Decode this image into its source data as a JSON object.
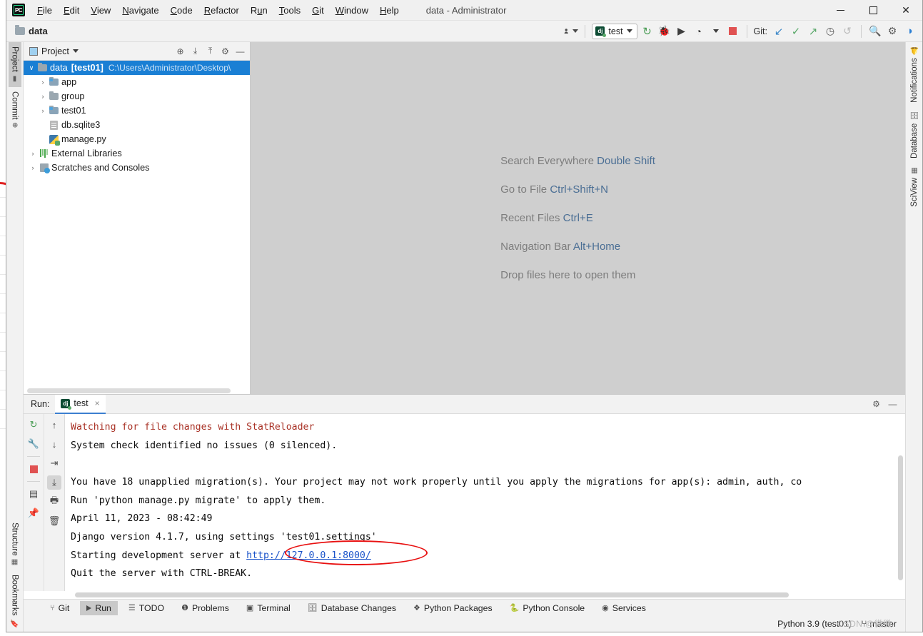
{
  "window": {
    "title": "data - Administrator",
    "app_icon": "pycharm-logo",
    "controls": {
      "minimize": "minimize",
      "maximize": "maximize",
      "close": "close"
    }
  },
  "menu": [
    {
      "label": "File",
      "mnemonic": "F"
    },
    {
      "label": "Edit",
      "mnemonic": "E"
    },
    {
      "label": "View",
      "mnemonic": "V"
    },
    {
      "label": "Navigate",
      "mnemonic": "N"
    },
    {
      "label": "Code",
      "mnemonic": "C"
    },
    {
      "label": "Refactor",
      "mnemonic": "R"
    },
    {
      "label": "Run",
      "mnemonic": "u"
    },
    {
      "label": "Tools",
      "mnemonic": "T"
    },
    {
      "label": "Git",
      "mnemonic": "G"
    },
    {
      "label": "Window",
      "mnemonic": "W"
    },
    {
      "label": "Help",
      "mnemonic": "H"
    }
  ],
  "navbar": {
    "breadcrumb": "data",
    "run_config": "test",
    "git_label": "Git:",
    "icons": [
      "user-select-icon",
      "rerun-icon",
      "debug-icon",
      "run-with-coverage-icon",
      "profile-icon",
      "stop-icon",
      "update-project-icon",
      "commit-icon",
      "push-icon",
      "history-icon",
      "rollback-icon",
      "search-icon",
      "settings-icon",
      "ide-assistant-icon"
    ]
  },
  "left_toolbar": [
    {
      "label": "Project",
      "icon": "project-icon",
      "active": true
    },
    {
      "label": "Commit",
      "icon": "commit-icon",
      "active": false
    }
  ],
  "left_toolbar_bottom": [
    {
      "label": "Structure",
      "icon": "structure-icon"
    },
    {
      "label": "Bookmarks",
      "icon": "bookmark-icon"
    }
  ],
  "right_toolbar": [
    {
      "label": "Notifications",
      "icon": "bell-icon"
    },
    {
      "label": "Database",
      "icon": "database-icon"
    },
    {
      "label": "SciView",
      "icon": "sciview-icon"
    }
  ],
  "project_panel": {
    "title": "Project",
    "actions": [
      "locate-icon",
      "expand-all-icon",
      "collapse-all-icon",
      "settings-icon",
      "hide-icon"
    ],
    "tree": [
      {
        "label": "data",
        "tag": "[test01]",
        "path": "C:\\Users\\Administrator\\Desktop\\",
        "icon": "folder-icon",
        "indent": 0,
        "arrow": "expanded",
        "selected": true
      },
      {
        "label": "app",
        "icon": "source-folder-icon",
        "indent": 1,
        "arrow": "collapsed",
        "selected": false
      },
      {
        "label": "group",
        "icon": "folder-icon",
        "indent": 1,
        "arrow": "collapsed",
        "selected": false
      },
      {
        "label": "test01",
        "icon": "source-folder-icon",
        "indent": 1,
        "arrow": "collapsed",
        "selected": false
      },
      {
        "label": "db.sqlite3",
        "icon": "file-icon",
        "indent": 1,
        "arrow": "none",
        "selected": false
      },
      {
        "label": "manage.py",
        "icon": "python-file-icon",
        "indent": 1,
        "arrow": "none",
        "selected": false
      },
      {
        "label": "External Libraries",
        "icon": "libraries-icon",
        "indent": 0,
        "arrow": "collapsed",
        "selected": false
      },
      {
        "label": "Scratches and Consoles",
        "icon": "scratches-icon",
        "indent": 0,
        "arrow": "collapsed",
        "selected": false
      }
    ]
  },
  "editor_hints": [
    {
      "text": "Search Everywhere ",
      "shortcut": "Double Shift"
    },
    {
      "text": "Go to File ",
      "shortcut": "Ctrl+Shift+N"
    },
    {
      "text": "Recent Files ",
      "shortcut": "Ctrl+E"
    },
    {
      "text": "Navigation Bar ",
      "shortcut": "Alt+Home"
    },
    {
      "text": "Drop files here to open them",
      "shortcut": ""
    }
  ],
  "run_window": {
    "label": "Run:",
    "tab": "test",
    "tab_icon": "django-icon",
    "close_tab": "×",
    "header_actions": [
      "settings-icon",
      "hide-icon"
    ],
    "gutter_left": [
      "rerun-icon",
      "configure-icon",
      "stop-icon",
      "layout-icon",
      "pin-icon"
    ],
    "gutter_right": [
      "up-icon",
      "down-icon",
      "soft-wrap-icon",
      "scroll-to-end-icon",
      "print-icon",
      "clear-all-icon"
    ],
    "console": [
      {
        "text": "Watching for file changes with StatReloader",
        "style": "error"
      },
      {
        "text": "System check identified no issues (0 silenced).",
        "style": "normal"
      },
      {
        "text": "",
        "style": "normal"
      },
      {
        "text": "You have 18 unapplied migration(s). Your project may not work properly until you apply the migrations for app(s): admin, auth, co",
        "style": "normal"
      },
      {
        "text": "Run 'python manage.py migrate' to apply them.",
        "style": "normal"
      },
      {
        "text": "April 11, 2023 - 08:42:49",
        "style": "normal"
      },
      {
        "text": "Django version 4.1.7, using settings 'test01.settings'",
        "style": "normal"
      },
      {
        "text": "Starting development server at ",
        "style": "normal",
        "link": "http://127.0.0.1:8000/",
        "annotated": true
      },
      {
        "text": "Quit the server with CTRL-BREAK.",
        "style": "normal"
      }
    ]
  },
  "bottom_bar": [
    {
      "label": "Git",
      "icon": "git-branch-icon",
      "active": false
    },
    {
      "label": "Run",
      "icon": "run-icon",
      "active": true
    },
    {
      "label": "TODO",
      "icon": "todo-icon",
      "active": false
    },
    {
      "label": "Problems",
      "icon": "problems-icon",
      "active": false
    },
    {
      "label": "Terminal",
      "icon": "terminal-icon",
      "active": false
    },
    {
      "label": "Database Changes",
      "icon": "database-changes-icon",
      "active": false
    },
    {
      "label": "Python Packages",
      "icon": "packages-icon",
      "active": false
    },
    {
      "label": "Python Console",
      "icon": "python-console-icon",
      "active": false
    },
    {
      "label": "Services",
      "icon": "services-icon",
      "active": false
    }
  ],
  "status_bar": {
    "interpreter": "Python 3.9 (test01)",
    "branch": "master",
    "branch_icon": "git-branch-icon",
    "watermark": "CSDN @微微"
  },
  "colors": {
    "accent_blue": "#1a7fd4",
    "link_blue": "#1a53c9",
    "error_red": "#a93226",
    "annotation_red": "#e81010",
    "editor_bg": "#cfcfcf",
    "panel_bg": "#f2f2f2"
  }
}
